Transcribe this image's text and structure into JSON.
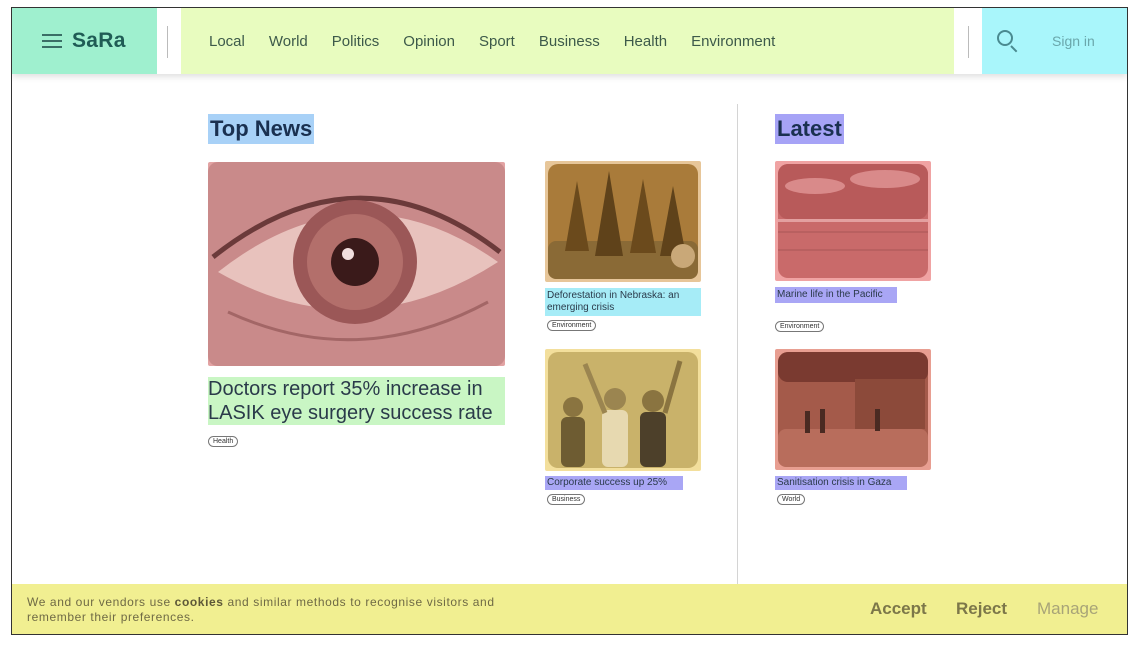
{
  "header": {
    "logo": "SaRa",
    "nav": [
      "Local",
      "World",
      "Politics",
      "Opinion",
      "Sport",
      "Business",
      "Health",
      "Environment"
    ],
    "signin_label": "Sign in"
  },
  "main": {
    "top_news_title": "Top News",
    "latest_title": "Latest",
    "top_story": {
      "headline": "Doctors report 35% increase in LASIK eye surgery success rate",
      "tag": "Health"
    },
    "side_stories": [
      {
        "headline": "Deforestation in Nebraska: an emerging crisis",
        "tag": "Environment"
      },
      {
        "headline": "Corporate success up 25%",
        "tag": "Business"
      }
    ],
    "latest_stories": [
      {
        "headline": "Marine life in the Pacific",
        "tag": "Environment"
      },
      {
        "headline": "Sanitisation crisis in Gaza",
        "tag": "World"
      }
    ]
  },
  "cookie": {
    "text_before": "We and our vendors use ",
    "text_bold": "cookies",
    "text_after": " and similar methods to recognise visitors and remember their preferences.",
    "accept": "Accept",
    "reject": "Reject",
    "manage": "Manage"
  },
  "colors": {
    "brand_bg": "#9ff0cf",
    "nav_bg": "#e8fcbf",
    "tools_bg": "#a9f6fb",
    "cookie_bg": "#f1ef91"
  }
}
